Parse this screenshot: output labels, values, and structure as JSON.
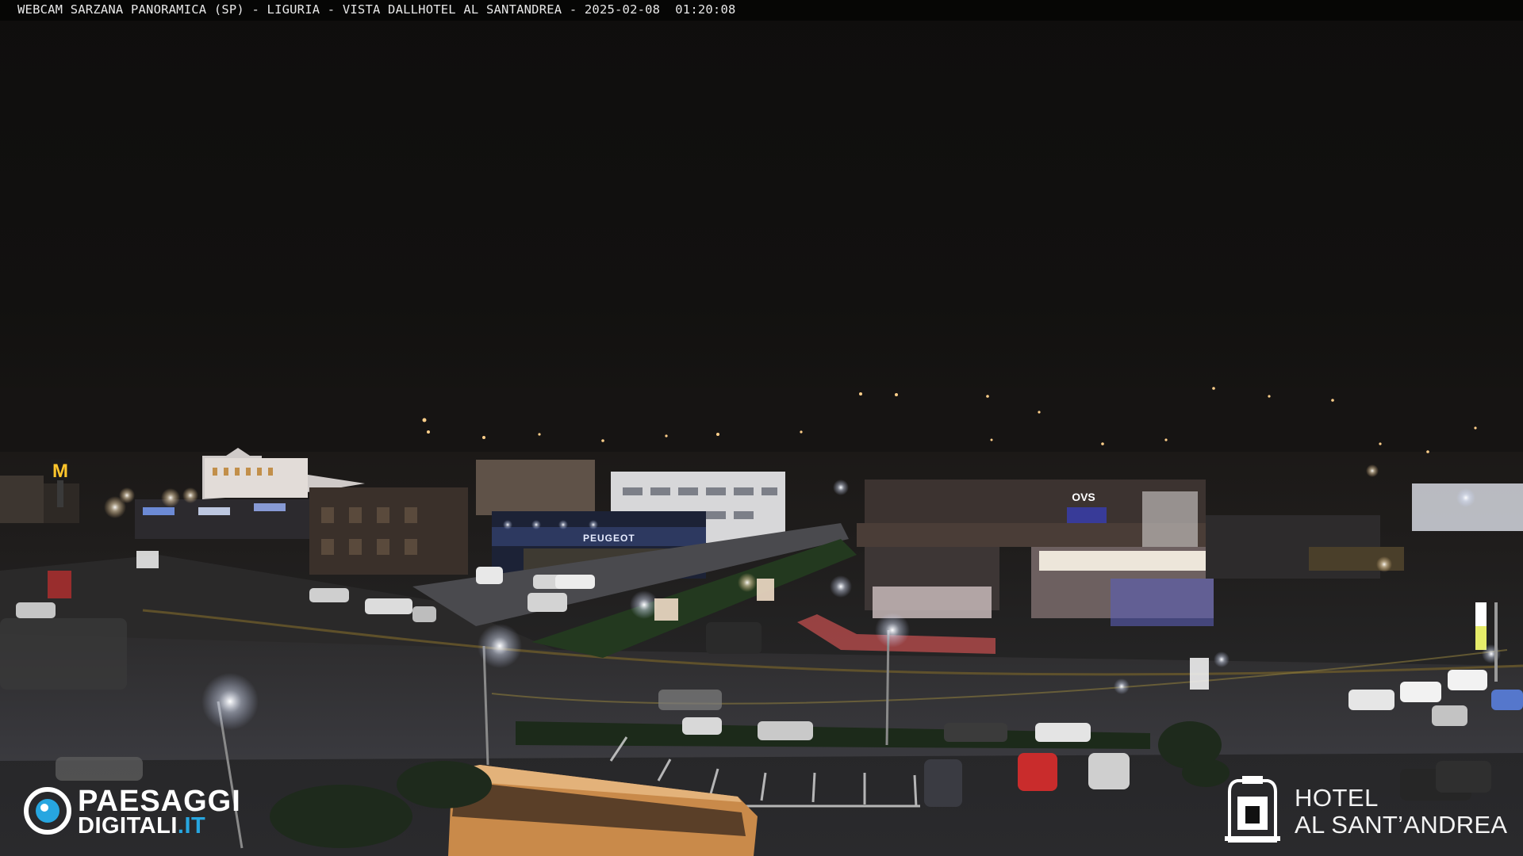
{
  "overlay": {
    "caption": "WEBCAM SARZANA PANORAMICA (SP) - LIGURIA - VISTA DALLHOTEL AL SANTANDREA - 2025-02-08  01:20:08"
  },
  "watermark_left": {
    "line1": "PAESAGGI",
    "line2_main": "DIGITALI",
    "line2_suffix": ".IT",
    "accent_color": "#27a6e0",
    "icon": "eye-logo-icon"
  },
  "watermark_right": {
    "line1": "HOTEL",
    "line2": "AL SANT’ANDREA",
    "icon": "hotel-crest-icon"
  },
  "scene": {
    "sign_left_building": "PEUGEOT",
    "sign_center_building": "OVS",
    "sign_mcdonalds": "M"
  }
}
